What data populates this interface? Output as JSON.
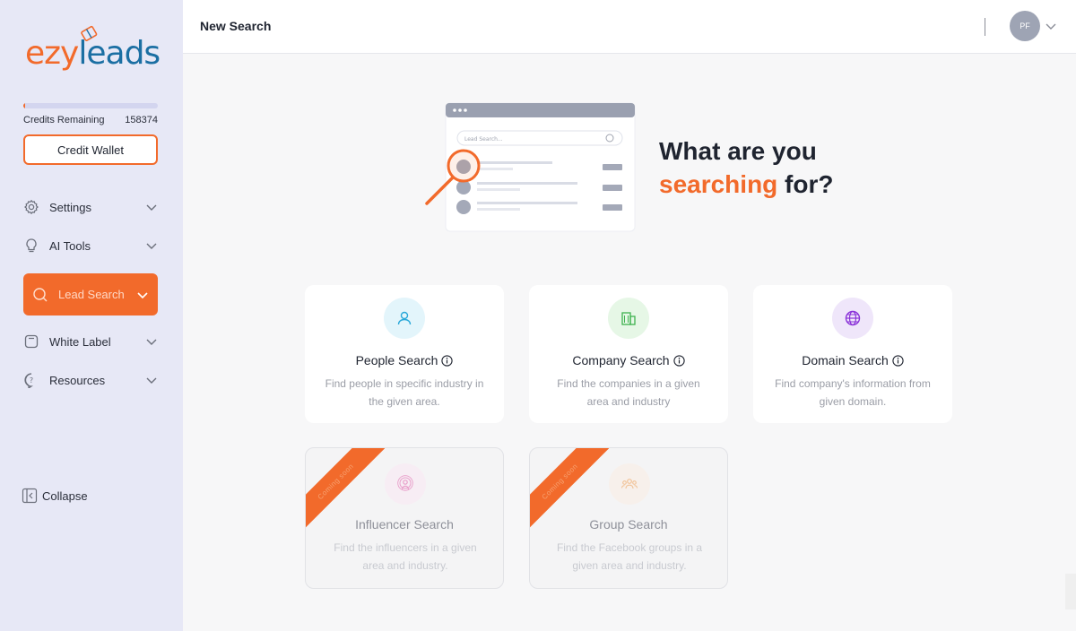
{
  "brand": {
    "part1": "ezy",
    "part2": "leads",
    "accent": "#f26a2b",
    "blue": "#1b6fa3"
  },
  "credits": {
    "label": "Credits Remaining",
    "value": "158374",
    "used_fraction": 0.01
  },
  "credit_wallet_label": "Credit Wallet",
  "nav": [
    {
      "label": "Settings",
      "icon": "gear-icon"
    },
    {
      "label": "AI Tools",
      "icon": "lightbulb-icon"
    },
    {
      "label": "Lead Search",
      "icon": "search-icon",
      "active": true
    },
    {
      "label": "White Label",
      "icon": "tag-icon"
    },
    {
      "label": "Resources",
      "icon": "help-icon"
    }
  ],
  "collapse_label": "Collapse",
  "header": {
    "title": "New Search",
    "avatar_initials": "PF"
  },
  "hero": {
    "line1": "What are you",
    "accent": "searching",
    "line2_rest": " for?",
    "illustration_search_placeholder": "Lead Search..."
  },
  "cards": [
    {
      "title": "People Search",
      "desc": "Find people in specific industry in the given area.",
      "icon": "person-icon",
      "enabled": true
    },
    {
      "title": "Company Search",
      "desc": "Find the companies in a given area and industry",
      "icon": "building-icon",
      "enabled": true
    },
    {
      "title": "Domain Search",
      "desc": "Find company's information from given domain.",
      "icon": "globe-icon",
      "enabled": true
    },
    {
      "title": "Influencer Search",
      "desc": "Find the influencers in a given area and industry.",
      "icon": "influencer-icon",
      "enabled": false,
      "ribbon": "Coming soon"
    },
    {
      "title": "Group Search",
      "desc": "Find the Facebook groups in a given area and industry.",
      "icon": "group-icon",
      "enabled": false,
      "ribbon": "Coming soon"
    }
  ]
}
